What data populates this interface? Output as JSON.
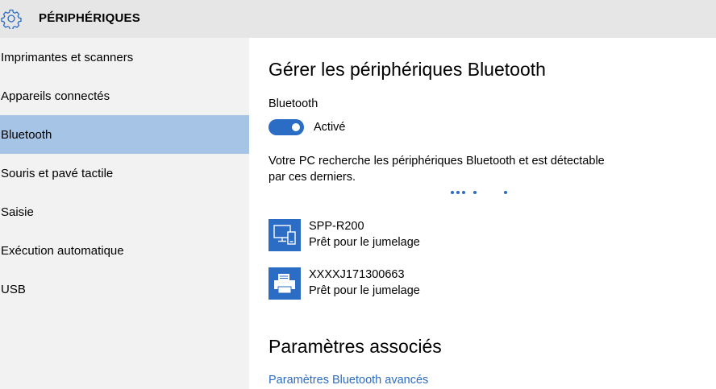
{
  "header": {
    "title": "PÉRIPHÉRIQUES",
    "icon": "gear-icon"
  },
  "sidebar": {
    "items": [
      {
        "label": "Imprimantes et scanners",
        "selected": false
      },
      {
        "label": "Appareils connectés",
        "selected": false
      },
      {
        "label": "Bluetooth",
        "selected": true
      },
      {
        "label": "Souris et pavé tactile",
        "selected": false
      },
      {
        "label": "Saisie",
        "selected": false
      },
      {
        "label": "Exécution automatique",
        "selected": false
      },
      {
        "label": "USB",
        "selected": false
      }
    ]
  },
  "main": {
    "heading": "Gérer les périphériques Bluetooth",
    "bluetooth_label": "Bluetooth",
    "toggle": {
      "on": true,
      "state_label": "Activé"
    },
    "description": "Votre PC recherche les périphériques Bluetooth et est détectable par ces derniers.",
    "devices": [
      {
        "name": "SPP-R200",
        "status": "Prêt pour le jumelage",
        "icon": "phone-monitor-icon"
      },
      {
        "name": "XXXXJ171300663",
        "status": "Prêt pour le jumelage",
        "icon": "printer-icon"
      }
    ],
    "related_heading": "Paramètres associés",
    "related_link": "Paramètres Bluetooth avancés"
  },
  "colors": {
    "accent": "#2b6cc4",
    "selected_bg": "#a6c5e6",
    "sidebar_bg": "#f2f2f2",
    "header_bg": "#e6e6e6"
  }
}
